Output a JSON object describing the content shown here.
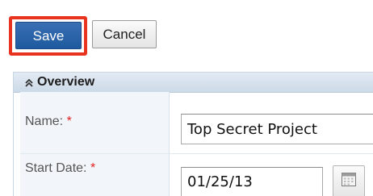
{
  "toolbar": {
    "save_label": "Save",
    "cancel_label": "Cancel",
    "highlight_color": "#e8331f",
    "save_color": "#2a63a8"
  },
  "panel": {
    "title": "Overview",
    "toggle_icon": "chevron-double-up-icon"
  },
  "fields": {
    "name": {
      "label": "Name:",
      "required_marker": "*",
      "value": "Top Secret Project"
    },
    "start_date": {
      "label": "Start Date:",
      "required_marker": "*",
      "value": "01/25/13",
      "picker_icon": "calendar-icon"
    }
  }
}
